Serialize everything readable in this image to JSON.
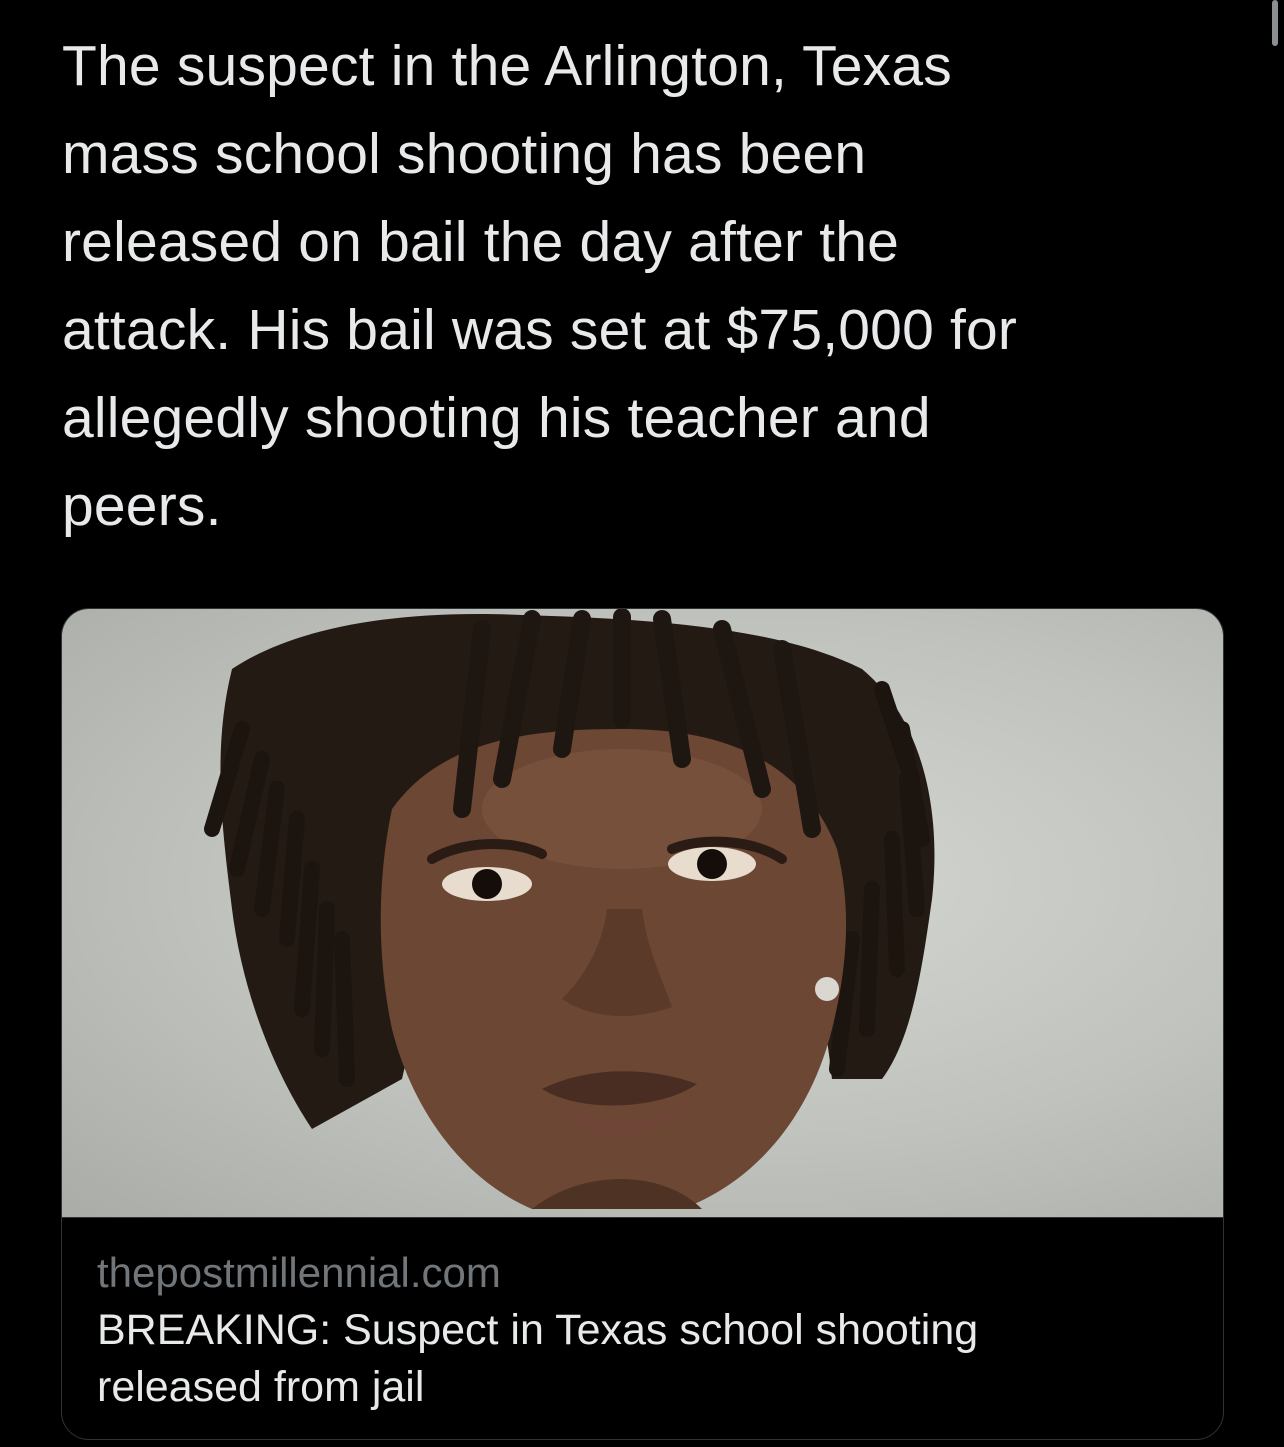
{
  "tweet": {
    "text": "The suspect in the Arlington, Texas\nmass school shooting has been\nreleased on bail the day after the\nattack. His bail was set at $75,000 for\nallegedly shooting his teacher and\npeers."
  },
  "link_card": {
    "domain": "thepostmillennial.com",
    "title": "BREAKING: Suspect in Texas school shooting\nreleased from jail"
  },
  "colors": {
    "background": "#000000",
    "text_primary": "#e7e9ea",
    "text_secondary": "#71767b",
    "card_border": "#2f3336"
  }
}
